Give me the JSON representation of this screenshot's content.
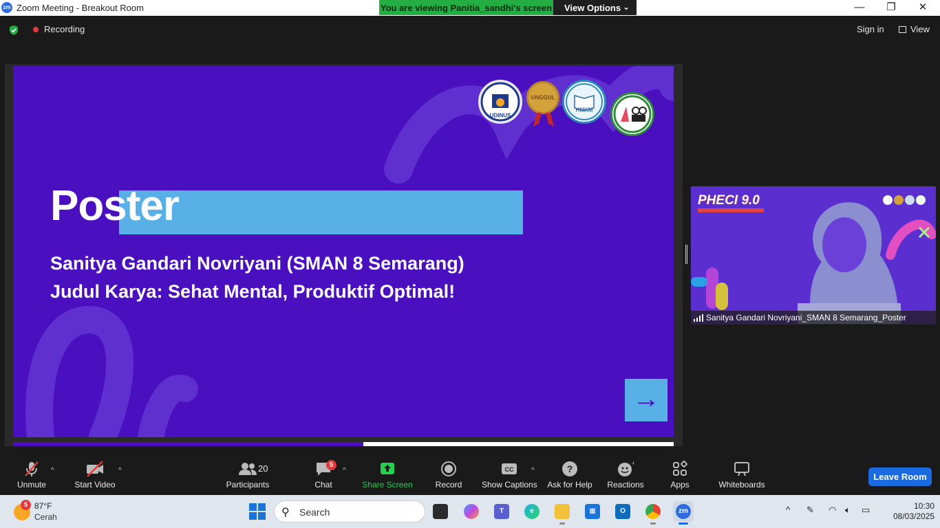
{
  "window": {
    "title": "Zoom Meeting - Breakout Room",
    "share_banner": "You are viewing Panitia_sandhi's screen",
    "view_options": "View Options"
  },
  "topbar": {
    "recording": "Recording",
    "sign_in": "Sign in",
    "view": "View"
  },
  "slide": {
    "title": "Poster",
    "line1": "Sanitya Gandari Novriyani (SMAN 8 Semarang)",
    "line2": "Judul Karya: Sehat Mental, Produktif Optimal!",
    "logo_udinus": "UDINUS",
    "logo_unggul": "UNGGUL",
    "logo_hmkm": "HMKM",
    "next_arrow": "→",
    "progress_fraction": 0.53
  },
  "video": {
    "event_title": "PHECI 9.0",
    "participant_name": "Sanitya Gandari Novriyani_SMAN 8 Semarang_Poster"
  },
  "toolbar": {
    "unmute": "Unmute",
    "start_video": "Start Video",
    "participants": "Participants",
    "participants_count": "20",
    "chat": "Chat",
    "chat_badge": "5",
    "share_screen": "Share Screen",
    "record": "Record",
    "show_captions": "Show Captions",
    "ask_for_help": "Ask for Help",
    "reactions": "Reactions",
    "apps": "Apps",
    "whiteboards": "Whiteboards",
    "leave_room": "Leave Room"
  },
  "taskbar": {
    "weather_badge": "5",
    "temperature": "87°F",
    "condition": "Cerah",
    "search_placeholder": "Search",
    "time": "10:30",
    "date": "08/03/2025"
  },
  "colors": {
    "slide_bg": "#4a10c0",
    "highlight": "#59b0e6",
    "share_green": "#23ad43",
    "leave_blue": "#1a6ae0"
  }
}
